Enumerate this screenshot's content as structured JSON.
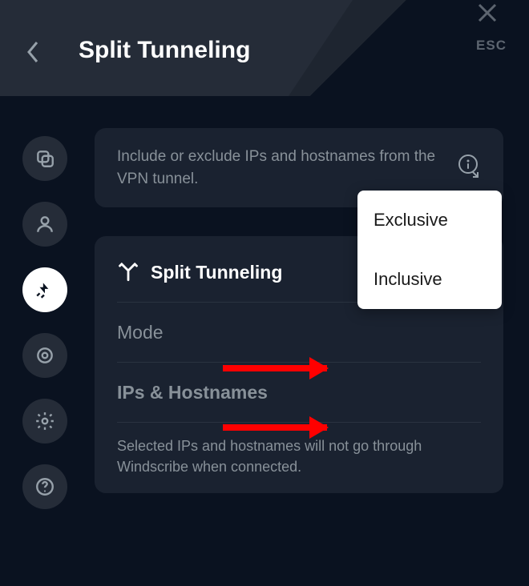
{
  "header": {
    "title": "Split Tunneling",
    "esc_label": "ESC"
  },
  "sidebar": {
    "items": [
      {
        "name": "general-icon"
      },
      {
        "name": "account-icon"
      },
      {
        "name": "connection-icon",
        "active": true
      },
      {
        "name": "robert-icon"
      },
      {
        "name": "settings-icon"
      },
      {
        "name": "help-icon"
      }
    ]
  },
  "info": {
    "text": "Include or exclude IPs and hostnames from the VPN tunnel."
  },
  "settings": {
    "split_label": "Split Tunneling",
    "split_enabled": true,
    "mode_label": "Mode",
    "ips_label": "IPs & Hostnames",
    "hint": "Selected IPs and hostnames will not go through Windscribe when connected."
  },
  "dropdown": {
    "options": [
      "Exclusive",
      "Inclusive"
    ]
  }
}
